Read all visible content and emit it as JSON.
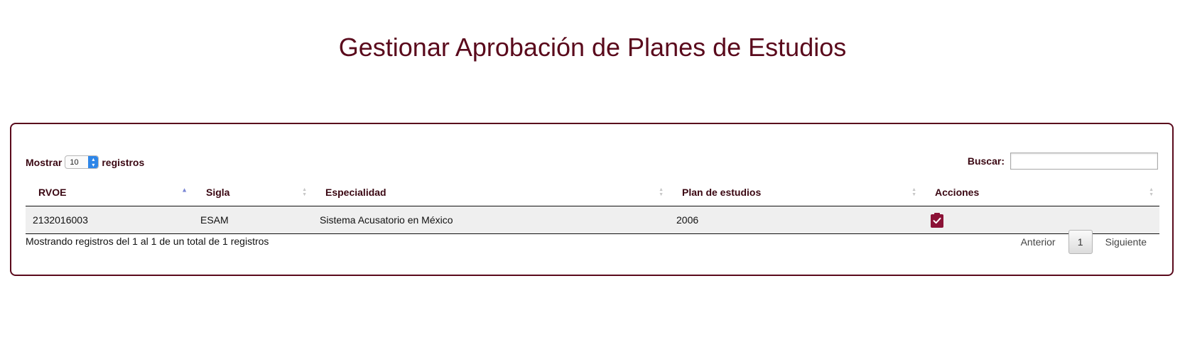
{
  "page": {
    "title": "Gestionar Aprobación de Planes de Estudios"
  },
  "length_control": {
    "prefix": "Mostrar",
    "value": "10",
    "suffix": "registros"
  },
  "search": {
    "label": "Buscar:",
    "value": ""
  },
  "table": {
    "columns": [
      {
        "label": "RVOE",
        "sort": "asc"
      },
      {
        "label": "Sigla",
        "sort": "none"
      },
      {
        "label": "Especialidad",
        "sort": "none"
      },
      {
        "label": "Plan de estudios",
        "sort": "none"
      },
      {
        "label": "Acciones",
        "sort": "none"
      }
    ],
    "rows": [
      {
        "rvoe": "2132016003",
        "sigla": "ESAM",
        "especialidad": "Sistema Acusatorio en México",
        "plan": "2006",
        "action_icon": "clipboard-check-icon"
      }
    ]
  },
  "footer": {
    "info": "Mostrando registros del 1 al 1 de un total de 1 registros",
    "pagination": {
      "previous": "Anterior",
      "current_page": "1",
      "next": "Siguiente"
    }
  },
  "colors": {
    "brand": "#5a0a1c",
    "action": "#8b1236",
    "row_bg": "#efefef"
  }
}
